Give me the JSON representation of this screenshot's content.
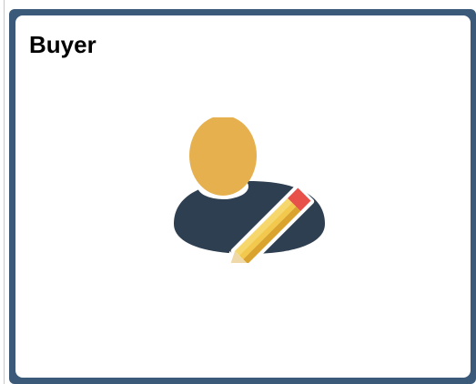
{
  "tile": {
    "title": "Buyer",
    "icon": "buyer-person-pencil-icon"
  },
  "colors": {
    "tile_border": "#3b5a79",
    "person_head": "#e6b04e",
    "person_body": "#2f3f52",
    "pencil_body": "#f2c94c",
    "pencil_eraser": "#e8514a"
  }
}
